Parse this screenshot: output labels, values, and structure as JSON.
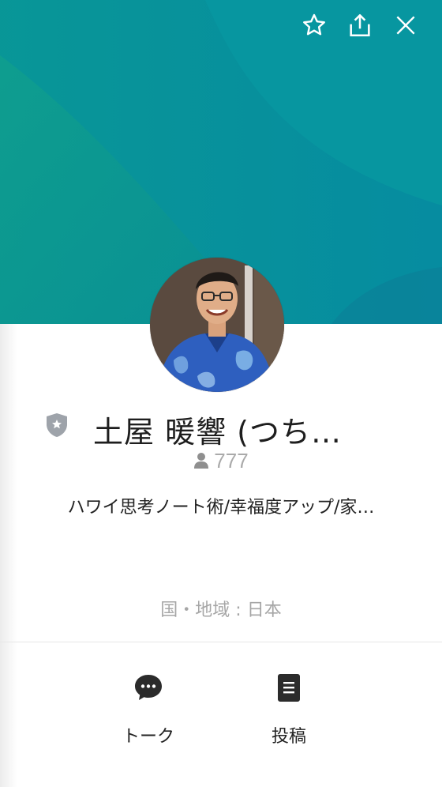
{
  "profile": {
    "name": "土屋 暖響 (つち…",
    "friend_count": "777",
    "status_message": "ハワイ思考ノート術/幸福度アップ/家…",
    "region": "国・地域 : 日本"
  },
  "header": {
    "icons": [
      "star-icon",
      "share-icon",
      "close-icon"
    ]
  },
  "actions": {
    "talk_label": "トーク",
    "post_label": "投稿"
  },
  "colors": {
    "cover_primary": "#06889c",
    "cover_secondary": "#0c9b8f",
    "icon_dark": "#2b2b2b",
    "badge_gray": "#9ea3aa"
  }
}
